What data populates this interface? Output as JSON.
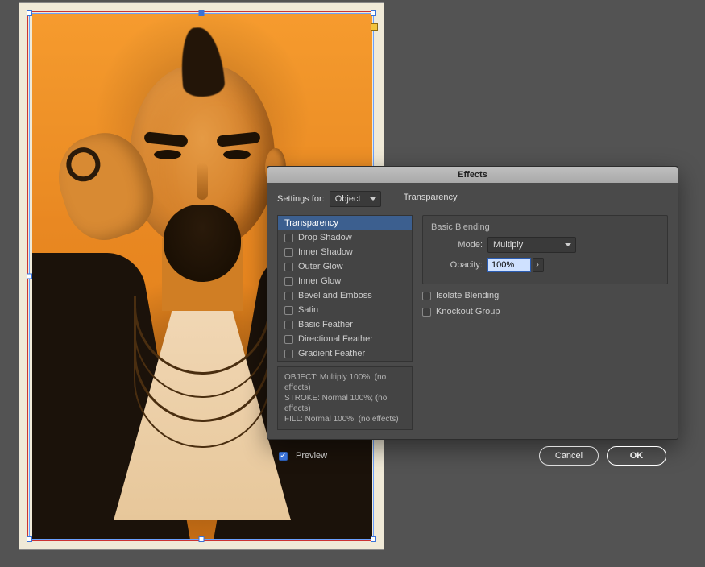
{
  "dialog": {
    "title": "Effects",
    "settings_for_label": "Settings for:",
    "settings_for_value": "Object",
    "section_title": "Transparency",
    "group_title": "Basic Blending",
    "mode_label": "Mode:",
    "mode_value": "Multiply",
    "opacity_label": "Opacity:",
    "opacity_value": "100%",
    "isolate_label": "Isolate Blending",
    "knockout_label": "Knockout Group",
    "preview_label": "Preview",
    "cancel": "Cancel",
    "ok": "OK"
  },
  "effects_list": [
    {
      "label": "Transparency",
      "checked": null,
      "selected": true
    },
    {
      "label": "Drop Shadow",
      "checked": false
    },
    {
      "label": "Inner Shadow",
      "checked": false
    },
    {
      "label": "Outer Glow",
      "checked": false
    },
    {
      "label": "Inner Glow",
      "checked": false
    },
    {
      "label": "Bevel and Emboss",
      "checked": false
    },
    {
      "label": "Satin",
      "checked": false
    },
    {
      "label": "Basic Feather",
      "checked": false
    },
    {
      "label": "Directional Feather",
      "checked": false
    },
    {
      "label": "Gradient Feather",
      "checked": false
    }
  ],
  "summary": {
    "line1": "OBJECT: Multiply 100%; (no effects)",
    "line2": "STROKE: Normal 100%; (no effects)",
    "line3": "FILL: Normal 100%; (no effects)"
  },
  "checkbox_states": {
    "isolate": false,
    "knockout": false,
    "preview": true
  }
}
